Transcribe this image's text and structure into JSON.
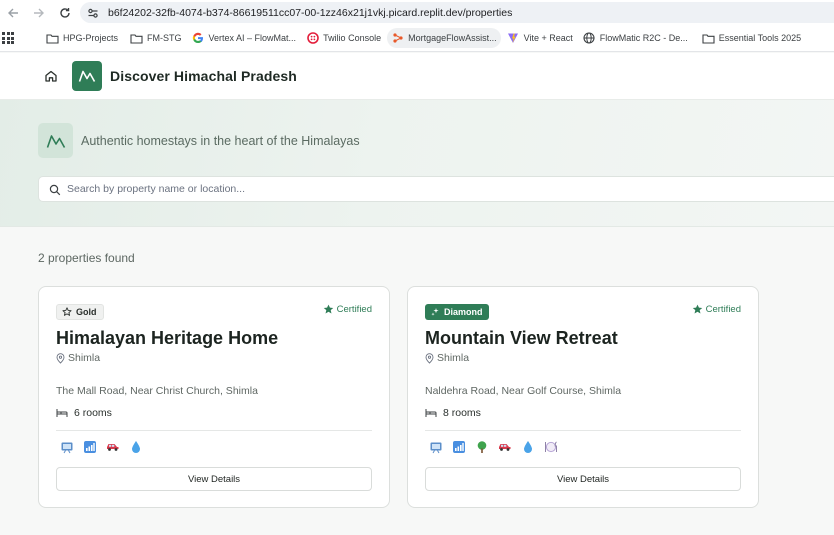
{
  "browser": {
    "url": "b6f24202-32fb-4074-b374-86619511cc07-00-1zz46x21j1vkj.picard.replit.dev/properties",
    "bookmarks": [
      {
        "label": "HPG-Projects",
        "icon": "folder-icon"
      },
      {
        "label": "FM-STG",
        "icon": "folder-icon"
      },
      {
        "label": "Vertex AI – FlowMat...",
        "icon": "google-icon"
      },
      {
        "label": "Twilio Console",
        "icon": "twilio-icon"
      },
      {
        "label": "MortgageFlowAssist...",
        "icon": "mortgageflow-icon"
      },
      {
        "label": "Vite + React",
        "icon": "vite-icon"
      },
      {
        "label": "FlowMatic R2C - De...",
        "icon": "globe-icon"
      },
      {
        "label": "Essential Tools 2025",
        "icon": "folder-icon"
      }
    ]
  },
  "app": {
    "title": "Discover Himachal Pradesh",
    "brand_color": "#2f7d57"
  },
  "hero": {
    "tagline": "Authentic homestays in the heart of the Himalayas",
    "search_placeholder": "Search by property name or location..."
  },
  "results": {
    "count_text": "2 properties found"
  },
  "properties": [
    {
      "badge": "Gold",
      "badge_icon": "star-outline-icon",
      "certified": "Certified",
      "name": "Himalayan Heritage Home",
      "location": "Shimla",
      "address": "The Mall Road, Near Christ Church, Shimla",
      "rooms": "6 rooms",
      "amenities": [
        "tv-icon",
        "wifi-signal-icon",
        "car-icon",
        "water-drop-icon"
      ],
      "button": "View Details"
    },
    {
      "badge": "Diamond",
      "badge_icon": "sparkle-icon",
      "certified": "Certified",
      "name": "Mountain View Retreat",
      "location": "Shimla",
      "address": "Naldehra Road, Near Golf Course, Shimla",
      "rooms": "8 rooms",
      "amenities": [
        "tv-icon",
        "wifi-signal-icon",
        "tree-icon",
        "car-icon",
        "water-drop-icon",
        "dining-icon"
      ],
      "button": "View Details"
    }
  ]
}
